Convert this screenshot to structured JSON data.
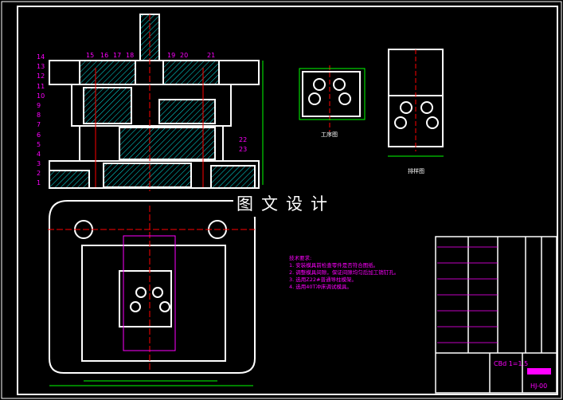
{
  "watermark": "图文设计",
  "section_view": {
    "part_numbers_left": [
      "14",
      "13",
      "12",
      "11",
      "10",
      "9",
      "8",
      "7",
      "6",
      "5",
      "4",
      "3",
      "2",
      "1"
    ],
    "part_numbers_top": [
      "15",
      "16",
      "17",
      "18",
      "19",
      "20",
      "21"
    ],
    "part_numbers_right": [
      "22",
      "23"
    ]
  },
  "process_drawing": {
    "caption": "工序图"
  },
  "strip_layout": {
    "caption": "排样图"
  },
  "technical_requirements": {
    "title": "技术要求:",
    "items": [
      "1. 安装模具前检查零件是否符合图纸。",
      "2. 调整模具间隙，保证间隙均匀后加工销钉孔。",
      "3. 选用Z22#普通导柱模架。",
      "4. 选用40T冲床调试模具。"
    ]
  },
  "title_block": {
    "scale": "CBd 1=1.5",
    "drawing_number": "HJ-00"
  },
  "colors": {
    "outline": "#ffffff",
    "hatch": "#00e5e5",
    "labels": "#ff00ff",
    "dimensions": "#00ff00",
    "centerlines": "#ff0000"
  }
}
